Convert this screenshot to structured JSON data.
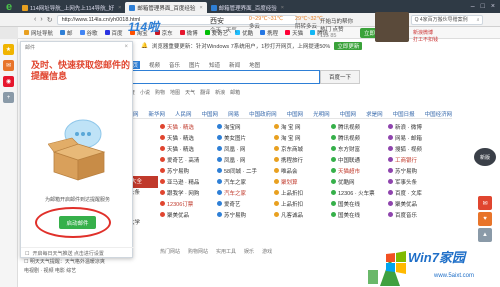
{
  "tabs": [
    {
      "label": "114网址导航_上网先上114导航_好",
      "color": "#e8a020",
      "active": false
    },
    {
      "label": "邮箱管理界面_百度经验",
      "color": "#2e7fd6",
      "active": true
    },
    {
      "label": "邮箱管理界面_百度经验",
      "color": "#2e7fd6",
      "active": false
    }
  ],
  "address": {
    "url": "http://www.114la.cn/yh0018.html",
    "search_text": "Q 4家百万搬伙导赠案例"
  },
  "bookmarks": [
    "网址导航",
    "邮",
    "谷歌",
    "百度",
    "淘宝",
    "京东",
    "微博",
    "爱奇艺",
    "优酷",
    "携程",
    "天猫",
    "腾讯"
  ],
  "bookmarks_btn": "立即登录",
  "notice": {
    "text": "浏览器重要更新：针对Windows 7系统用户，1秒打开网页，上网提速50%",
    "btn": "立即更新"
  },
  "site_logo": "114啦",
  "weather": {
    "city": "西安",
    "sub": "今天 · 天气",
    "today": "0~29℃~31℃",
    "today_desc": "多云",
    "tomorrow": "29℃~32℃",
    "tomorrow_desc": "阴转多云"
  },
  "promo": {
    "title": "开始马的帮你",
    "line1": "热门 点赞",
    "num1": "115",
    "num2": "85"
  },
  "weibo_links": [
    "新浪微博",
    "打工不扣钱"
  ],
  "search_tabs": [
    "网页",
    "视频",
    "音乐",
    "图片",
    "知道",
    "新闻",
    "地图"
  ],
  "search_btn": "百度一下",
  "hot_words": [
    "百度",
    "小说",
    "购物",
    "地图",
    "天气",
    "翻译",
    "新浪",
    "邮箱"
  ],
  "site_row": [
    "央视网",
    "新华网",
    "人民网",
    "中国网",
    "网易",
    "中国政府网",
    "中国网",
    "光明网",
    "中国网",
    "求是网",
    "中国日报",
    "中国经济网"
  ],
  "grid": [
    [
      "天猫 · 精选",
      "淘宝网",
      "淘 宝 网",
      "腾讯视频",
      "新浪 · 微博"
    ],
    [
      "天猫 · 精选",
      "美女图片",
      "淘 宝 网",
      "腾讯视频",
      "网易 · 邮箱"
    ],
    [
      "天猫 · 精选",
      "凤凰 · 网",
      "京东商城",
      "东方财富",
      "搜狐 · 视频"
    ],
    [
      "爱奇艺 · 高清",
      "凤凰 · 网",
      "携程旅行",
      "中国联通",
      "工商银行"
    ],
    [
      "苏宁易购",
      "58同城 · 二手",
      "唯品会",
      "天猫超市",
      "苏宁易购"
    ],
    [
      "亚马逊 · 精品",
      "汽车之家",
      "聚划算",
      "优酷网",
      "军事头条"
    ],
    [
      "跟我学 · 网购",
      "汽车之家",
      "上品折扣",
      "12306 · 火车票",
      "百度 · 文库"
    ],
    [
      "12306订票",
      "爱奇艺",
      "上品折扣",
      "国美在线",
      "聚美优品"
    ],
    [
      "聚美优品",
      "苏宁易购",
      "凡客诚品",
      "国美在线",
      "百度音乐"
    ]
  ],
  "left_col": [
    "小说大全",
    "今日头条",
    "天猫",
    "国美",
    "中国大学"
  ],
  "pager": "1/2",
  "bottom_cats": [
    "电视剧 · 视频",
    "电影",
    "综艺"
  ],
  "bottom_cats2": [
    "热门网站",
    "购物网站",
    "实用工具",
    "娱乐",
    "游戏"
  ],
  "popup": {
    "header": "邮件",
    "title_line1": "及时、快速获取您邮件的",
    "title_line2": "提醒信息",
    "tip": "为邮箱开启邮件到达提醒服务",
    "button": "启动邮件",
    "footer": "开启每日天气推送 点击进行设置"
  },
  "lower_strip": [
    "☐ 明天天气提醒：天气格外温暖凉爽",
    "电视剧 · 视频   电影   综艺"
  ],
  "watermark": {
    "title": "Win7家园",
    "url": "www.5aixt.com"
  },
  "mascot_label": "新版"
}
